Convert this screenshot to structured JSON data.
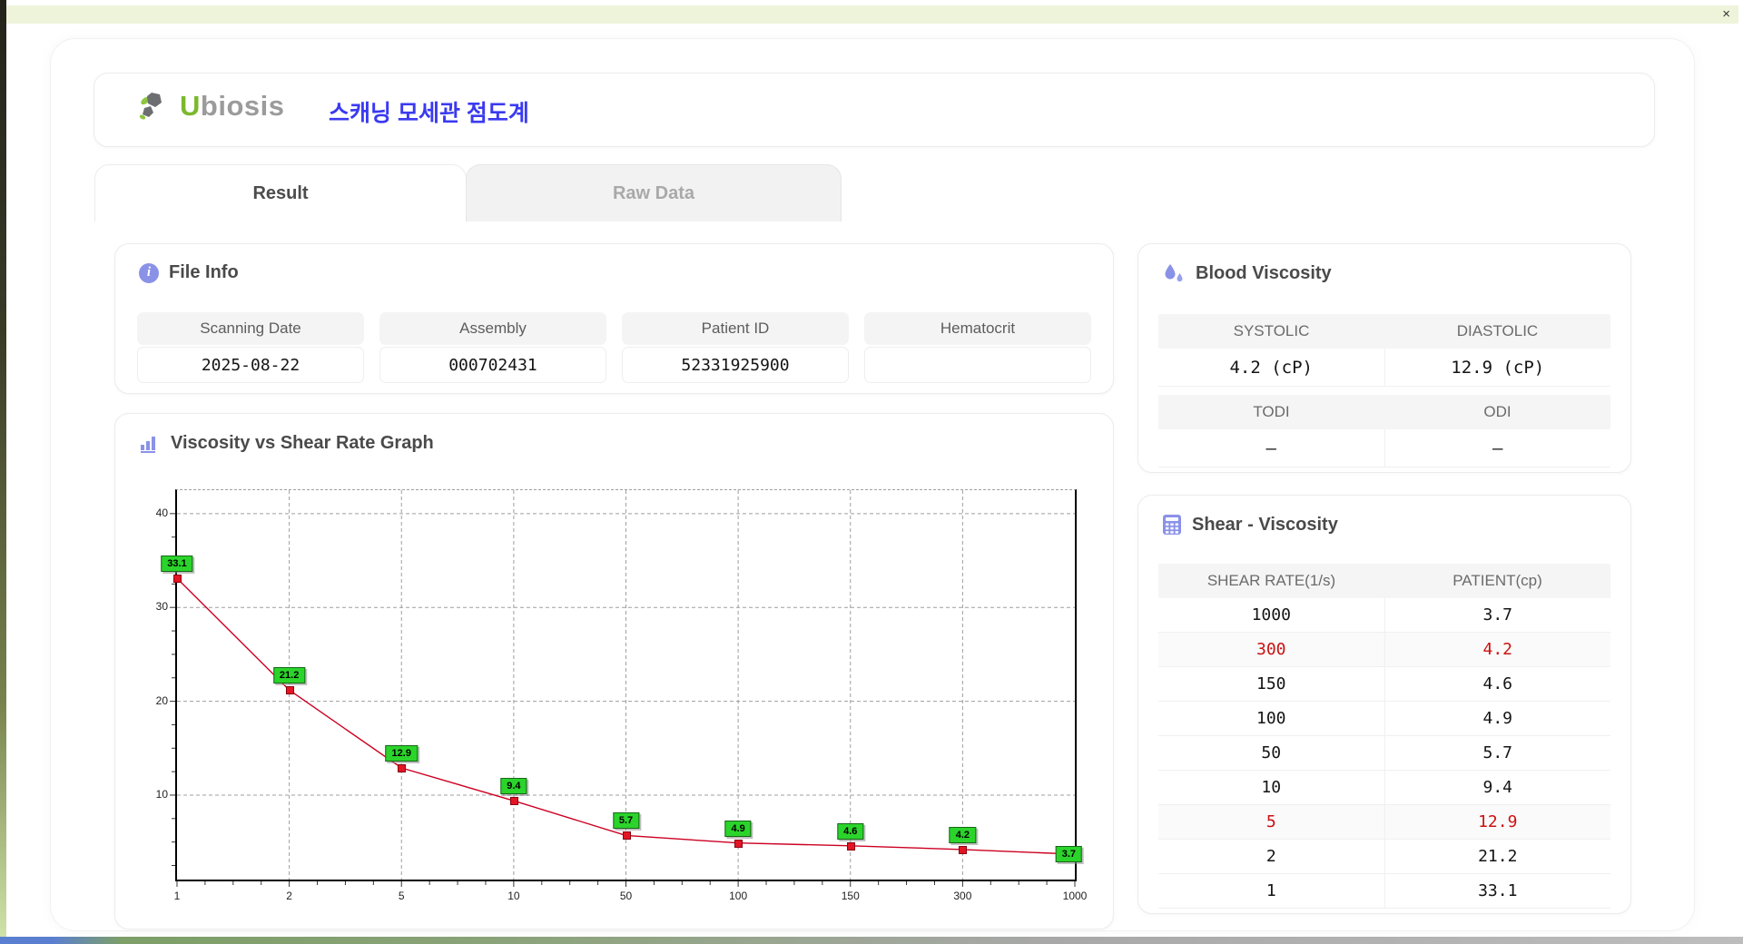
{
  "window": {
    "title_bar_color": "#eef4da",
    "close_label": "×"
  },
  "header": {
    "logo": {
      "u": "U",
      "rest": "biosis"
    },
    "app_title": "스캐닝 모세관 점도계",
    "title_color": "#3a3af0"
  },
  "tabs": [
    {
      "label": "Result",
      "active": true
    },
    {
      "label": "Raw Data",
      "active": false
    }
  ],
  "file_info": {
    "title": "File Info",
    "fields": [
      {
        "label": "Scanning Date",
        "value": "2025-08-22"
      },
      {
        "label": "Assembly",
        "value": "000702431"
      },
      {
        "label": "Patient ID",
        "value": "52331925900"
      },
      {
        "label": "Hematocrit",
        "value": ""
      }
    ]
  },
  "blood_viscosity": {
    "title": "Blood Viscosity",
    "metric_rows": [
      [
        {
          "label": "SYSTOLIC",
          "value": "4.2 (cP)"
        },
        {
          "label": "DIASTOLIC",
          "value": "12.9 (cP)"
        }
      ],
      [
        {
          "label": "TODI",
          "value": "–"
        },
        {
          "label": "ODI",
          "value": "–"
        }
      ]
    ]
  },
  "graph_section": {
    "title": "Viscosity vs Shear Rate Graph"
  },
  "chart_data": {
    "type": "line",
    "title": "Viscosity vs Shear Rate Graph",
    "x_categories": [
      "1",
      "2",
      "5",
      "10",
      "50",
      "100",
      "150",
      "300",
      "1000"
    ],
    "series": [
      {
        "name": "PATIENT(cp)",
        "color": "#cc0022",
        "values": [
          33.1,
          21.2,
          12.9,
          9.4,
          5.7,
          4.9,
          4.6,
          4.2,
          3.7
        ]
      }
    ],
    "point_labels": [
      "33.1",
      "21.2",
      "12.9",
      "9.4",
      "5.7",
      "4.9",
      "4.6",
      "4.2",
      "3.7"
    ],
    "xlabel": "",
    "ylabel": "",
    "ylim": [
      1,
      42.5
    ],
    "yticks": [
      10,
      20,
      30,
      40
    ],
    "x_scale": "category-evenly-spaced",
    "grid": "dashed",
    "legend": "none",
    "marker_color": "#e31424",
    "marker_border": "#8a0010",
    "point_label_bg": "#2bd42b",
    "point_label_border": "#156615"
  },
  "shear_table": {
    "title": "Shear - Viscosity",
    "columns": [
      "SHEAR RATE(1/s)",
      "PATIENT(cp)"
    ],
    "highlight_color": "#cc1111",
    "rows": [
      {
        "shear_rate": "1000",
        "patient": "3.7",
        "highlight": false
      },
      {
        "shear_rate": "300",
        "patient": "4.2",
        "highlight": true
      },
      {
        "shear_rate": "150",
        "patient": "4.6",
        "highlight": false
      },
      {
        "shear_rate": "100",
        "patient": "4.9",
        "highlight": false
      },
      {
        "shear_rate": "50",
        "patient": "5.7",
        "highlight": false
      },
      {
        "shear_rate": "10",
        "patient": "9.4",
        "highlight": false
      },
      {
        "shear_rate": "5",
        "patient": "12.9",
        "highlight": true
      },
      {
        "shear_rate": "2",
        "patient": "21.2",
        "highlight": false
      },
      {
        "shear_rate": "1",
        "patient": "33.1",
        "highlight": false
      }
    ]
  }
}
